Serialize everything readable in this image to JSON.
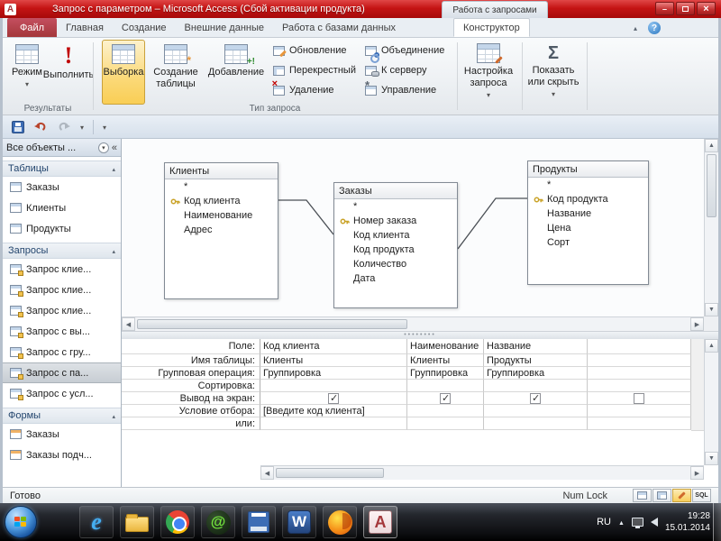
{
  "window": {
    "title": "Запрос с параметром – Microsoft Access (Сбой активации продукта)",
    "contextual_group": "Работа с запросами"
  },
  "icons": {
    "app": "A",
    "help": "?",
    "run_exclamation": "!",
    "sigma": "Σ",
    "ie": "e",
    "mail": "@",
    "word": "W",
    "access": "A"
  },
  "tabs": {
    "file": "Файл",
    "items": [
      "Главная",
      "Создание",
      "Внешние данные",
      "Работа с базами данных"
    ],
    "active": "Конструктор"
  },
  "ribbon": {
    "results": {
      "label": "Результаты",
      "mode": "Режим",
      "run": "Выполнить"
    },
    "query_type": {
      "label": "Тип запроса",
      "select": "Выборка",
      "make_table": "Создание таблицы",
      "append": "Добавление",
      "small": [
        "Обновление",
        "Перекрестный",
        "Удаление",
        "Объединение",
        "К серверу",
        "Управление"
      ]
    },
    "query_setup": {
      "label": "Настройка запроса"
    },
    "show_hide": {
      "label": "Показать или скрыть"
    }
  },
  "nav": {
    "header": "Все объекты ...",
    "sections": [
      {
        "title": "Таблицы",
        "items": [
          {
            "label": "Заказы"
          },
          {
            "label": "Клиенты"
          },
          {
            "label": "Продукты"
          }
        ]
      },
      {
        "title": "Запросы",
        "items": [
          {
            "label": "Запрос клие..."
          },
          {
            "label": "Запрос клие..."
          },
          {
            "label": "Запрос клие..."
          },
          {
            "label": "Запрос с вы..."
          },
          {
            "label": "Запрос с гру..."
          },
          {
            "label": "Запрос с па..."
          },
          {
            "label": "Запрос с усл..."
          }
        ]
      },
      {
        "title": "Формы",
        "items": [
          {
            "label": "Заказы"
          },
          {
            "label": "Заказы подч..."
          }
        ]
      }
    ]
  },
  "designer": {
    "tables": [
      {
        "name": "Клиенты",
        "key": "Код клиента",
        "fields": [
          "*",
          "Код клиента",
          "Наименование",
          "Адрес"
        ]
      },
      {
        "name": "Заказы",
        "key": "Номер заказа",
        "fields": [
          "*",
          "Номер заказа",
          "Код клиента",
          "Код продукта",
          "Количество",
          "Дата"
        ]
      },
      {
        "name": "Продукты",
        "key": "Код продукта",
        "fields": [
          "*",
          "Код продукта",
          "Название",
          "Цена",
          "Сорт"
        ]
      }
    ]
  },
  "grid": {
    "row_labels": [
      "Поле:",
      "Имя таблицы:",
      "Групповая операция:",
      "Сортировка:",
      "Вывод на экран:",
      "Условие отбора:",
      "или:"
    ],
    "columns": [
      {
        "field": "Код клиента",
        "table": "Клиенты",
        "group": "Группировка",
        "sort": "",
        "show": true,
        "criteria": "[Введите код клиента]",
        "or": ""
      },
      {
        "field": "Наименование",
        "table": "Клиенты",
        "group": "Группировка",
        "sort": "",
        "show": true,
        "criteria": "",
        "or": ""
      },
      {
        "field": "Название",
        "table": "Продукты",
        "group": "Группировка",
        "sort": "",
        "show": true,
        "criteria": "",
        "or": ""
      },
      {
        "field": "",
        "table": "",
        "group": "",
        "sort": "",
        "show": false,
        "criteria": "",
        "or": ""
      }
    ]
  },
  "status": {
    "ready": "Готово",
    "num_lock": "Num Lock",
    "sql": "SQL"
  },
  "taskbar": {
    "lang": "RU",
    "time": "19:28",
    "date": "15.01.2014"
  }
}
